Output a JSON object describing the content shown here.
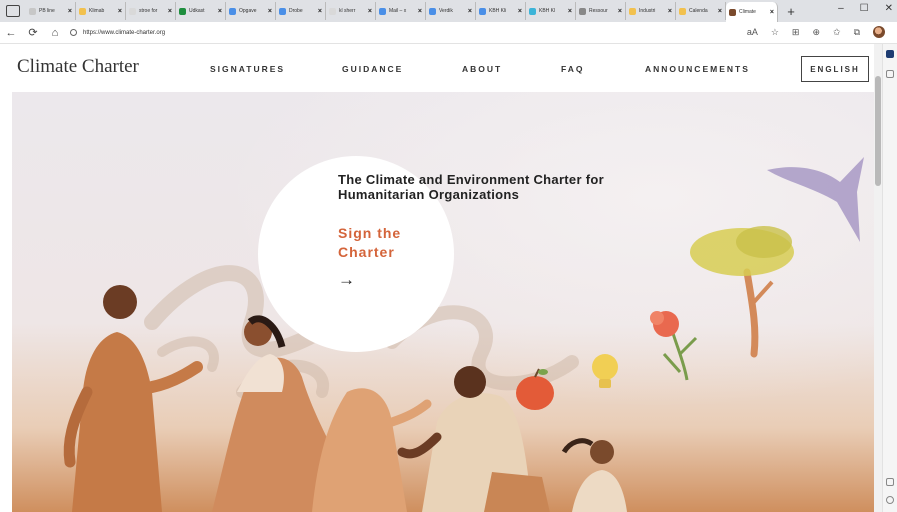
{
  "browser": {
    "tabs": [
      {
        "label": "PB line",
        "color": "#c7c7c7"
      },
      {
        "label": "Klimab",
        "color": "#f2c14e"
      },
      {
        "label": "stroe for",
        "color": "#d9d9d9"
      },
      {
        "label": "Udkast",
        "color": "#1e8e3e"
      },
      {
        "label": "Opgave",
        "color": "#4a8fe7"
      },
      {
        "label": "Drobe",
        "color": "#4a8fe7"
      },
      {
        "label": "kl sherr",
        "color": "#d9d9d9"
      },
      {
        "label": "Mail – x",
        "color": "#4a8fe7"
      },
      {
        "label": "Verdik",
        "color": "#4a8fe7"
      },
      {
        "label": "KBH Kli",
        "color": "#4a8fe7"
      },
      {
        "label": "KBH Kl",
        "color": "#3cb4d8"
      },
      {
        "label": "Ressour",
        "color": "#888"
      },
      {
        "label": "Industri",
        "color": "#f2c14e"
      },
      {
        "label": "Calenda",
        "color": "#f2c14e"
      },
      {
        "label": "Climate",
        "color": "#7a4a2c",
        "active": true
      }
    ],
    "new_tab": "+",
    "window_controls": [
      "–",
      "☐",
      "✕"
    ],
    "back": "←",
    "refresh": "⟳",
    "home": "⌂",
    "url": "https://www.climate-charter.org",
    "toolbar_icons": [
      "aA",
      "☆",
      "⊞",
      "⊕",
      "✩",
      "⧉"
    ]
  },
  "site": {
    "logo": "Climate Charter",
    "nav": [
      "SIGNATURES",
      "GUIDANCE",
      "ABOUT",
      "FAQ",
      "ANNOUNCEMENTS"
    ],
    "language_button": "ENGLISH"
  },
  "hero": {
    "title": "The Climate and Environment Charter for Humanitarian Organizations",
    "cta": "Sign the Charter",
    "cta_arrow": "→"
  },
  "colors": {
    "accent": "#d4643a",
    "text": "#222222"
  }
}
